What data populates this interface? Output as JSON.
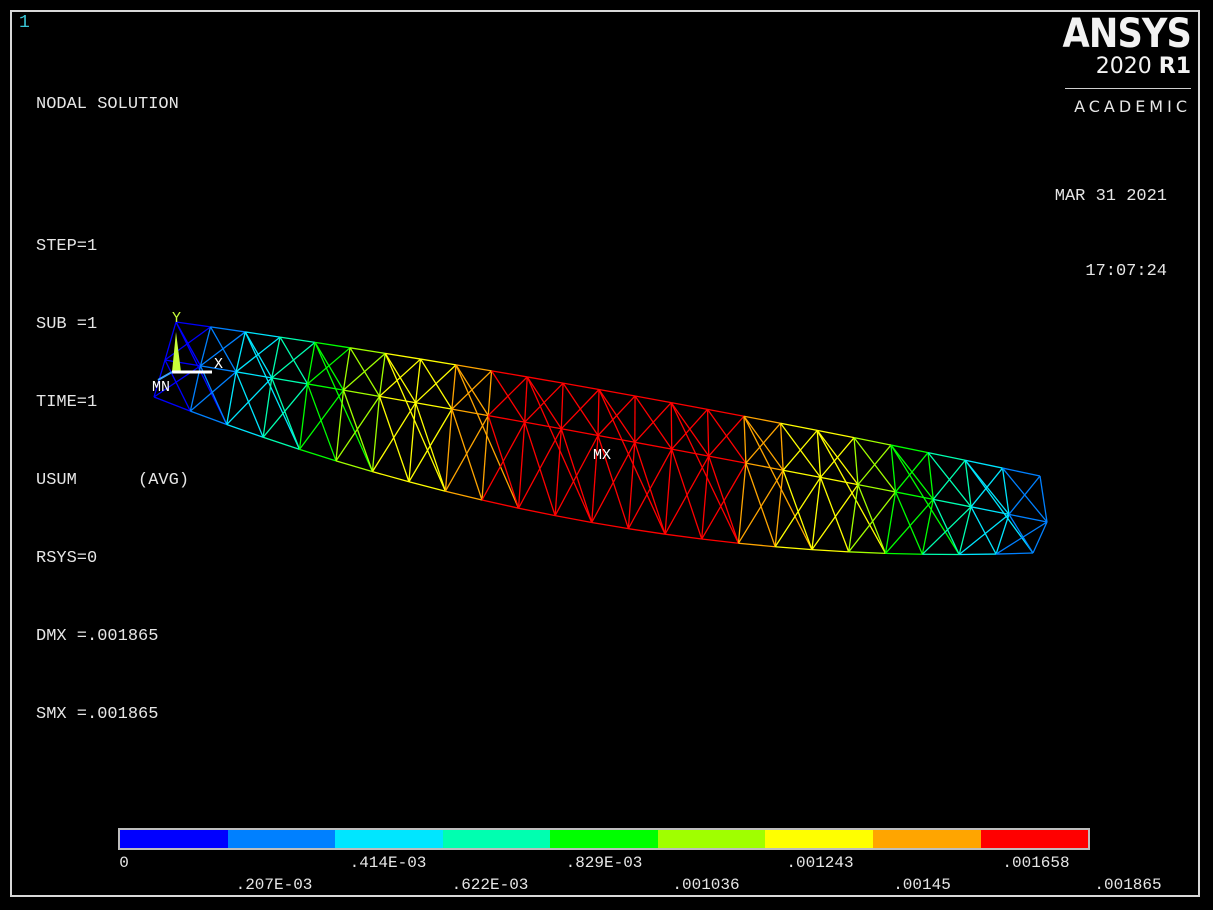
{
  "window": {
    "number": "1"
  },
  "info": {
    "title": "NODAL SOLUTION",
    "lines": [
      "STEP=1",
      "SUB =1",
      "TIME=1",
      "USUM      (AVG)",
      "RSYS=0",
      "DMX =.001865",
      "SMX =.001865"
    ]
  },
  "logo": {
    "name": "ANSYS",
    "version_year": "2020",
    "version_release": "R1",
    "edition": "ACADEMIC"
  },
  "datetime": {
    "date": "MAR 31 2021",
    "time": "17:07:24"
  },
  "model": {
    "triad": {
      "y_label": "Y",
      "x_label": "X"
    },
    "min_marker": "MN",
    "max_marker": "MX"
  },
  "legend": {
    "colors": [
      "#0000ff",
      "#0080ff",
      "#00e6ff",
      "#00ffb0",
      "#00ff00",
      "#a0ff00",
      "#ffff00",
      "#ffa500",
      "#ff0000"
    ],
    "top_labels": [
      "0",
      ".414E-03",
      ".829E-03",
      ".001243",
      ".001658"
    ],
    "bottom_labels": [
      ".207E-03",
      ".622E-03",
      ".001036",
      ".00145",
      ".001865"
    ]
  }
}
